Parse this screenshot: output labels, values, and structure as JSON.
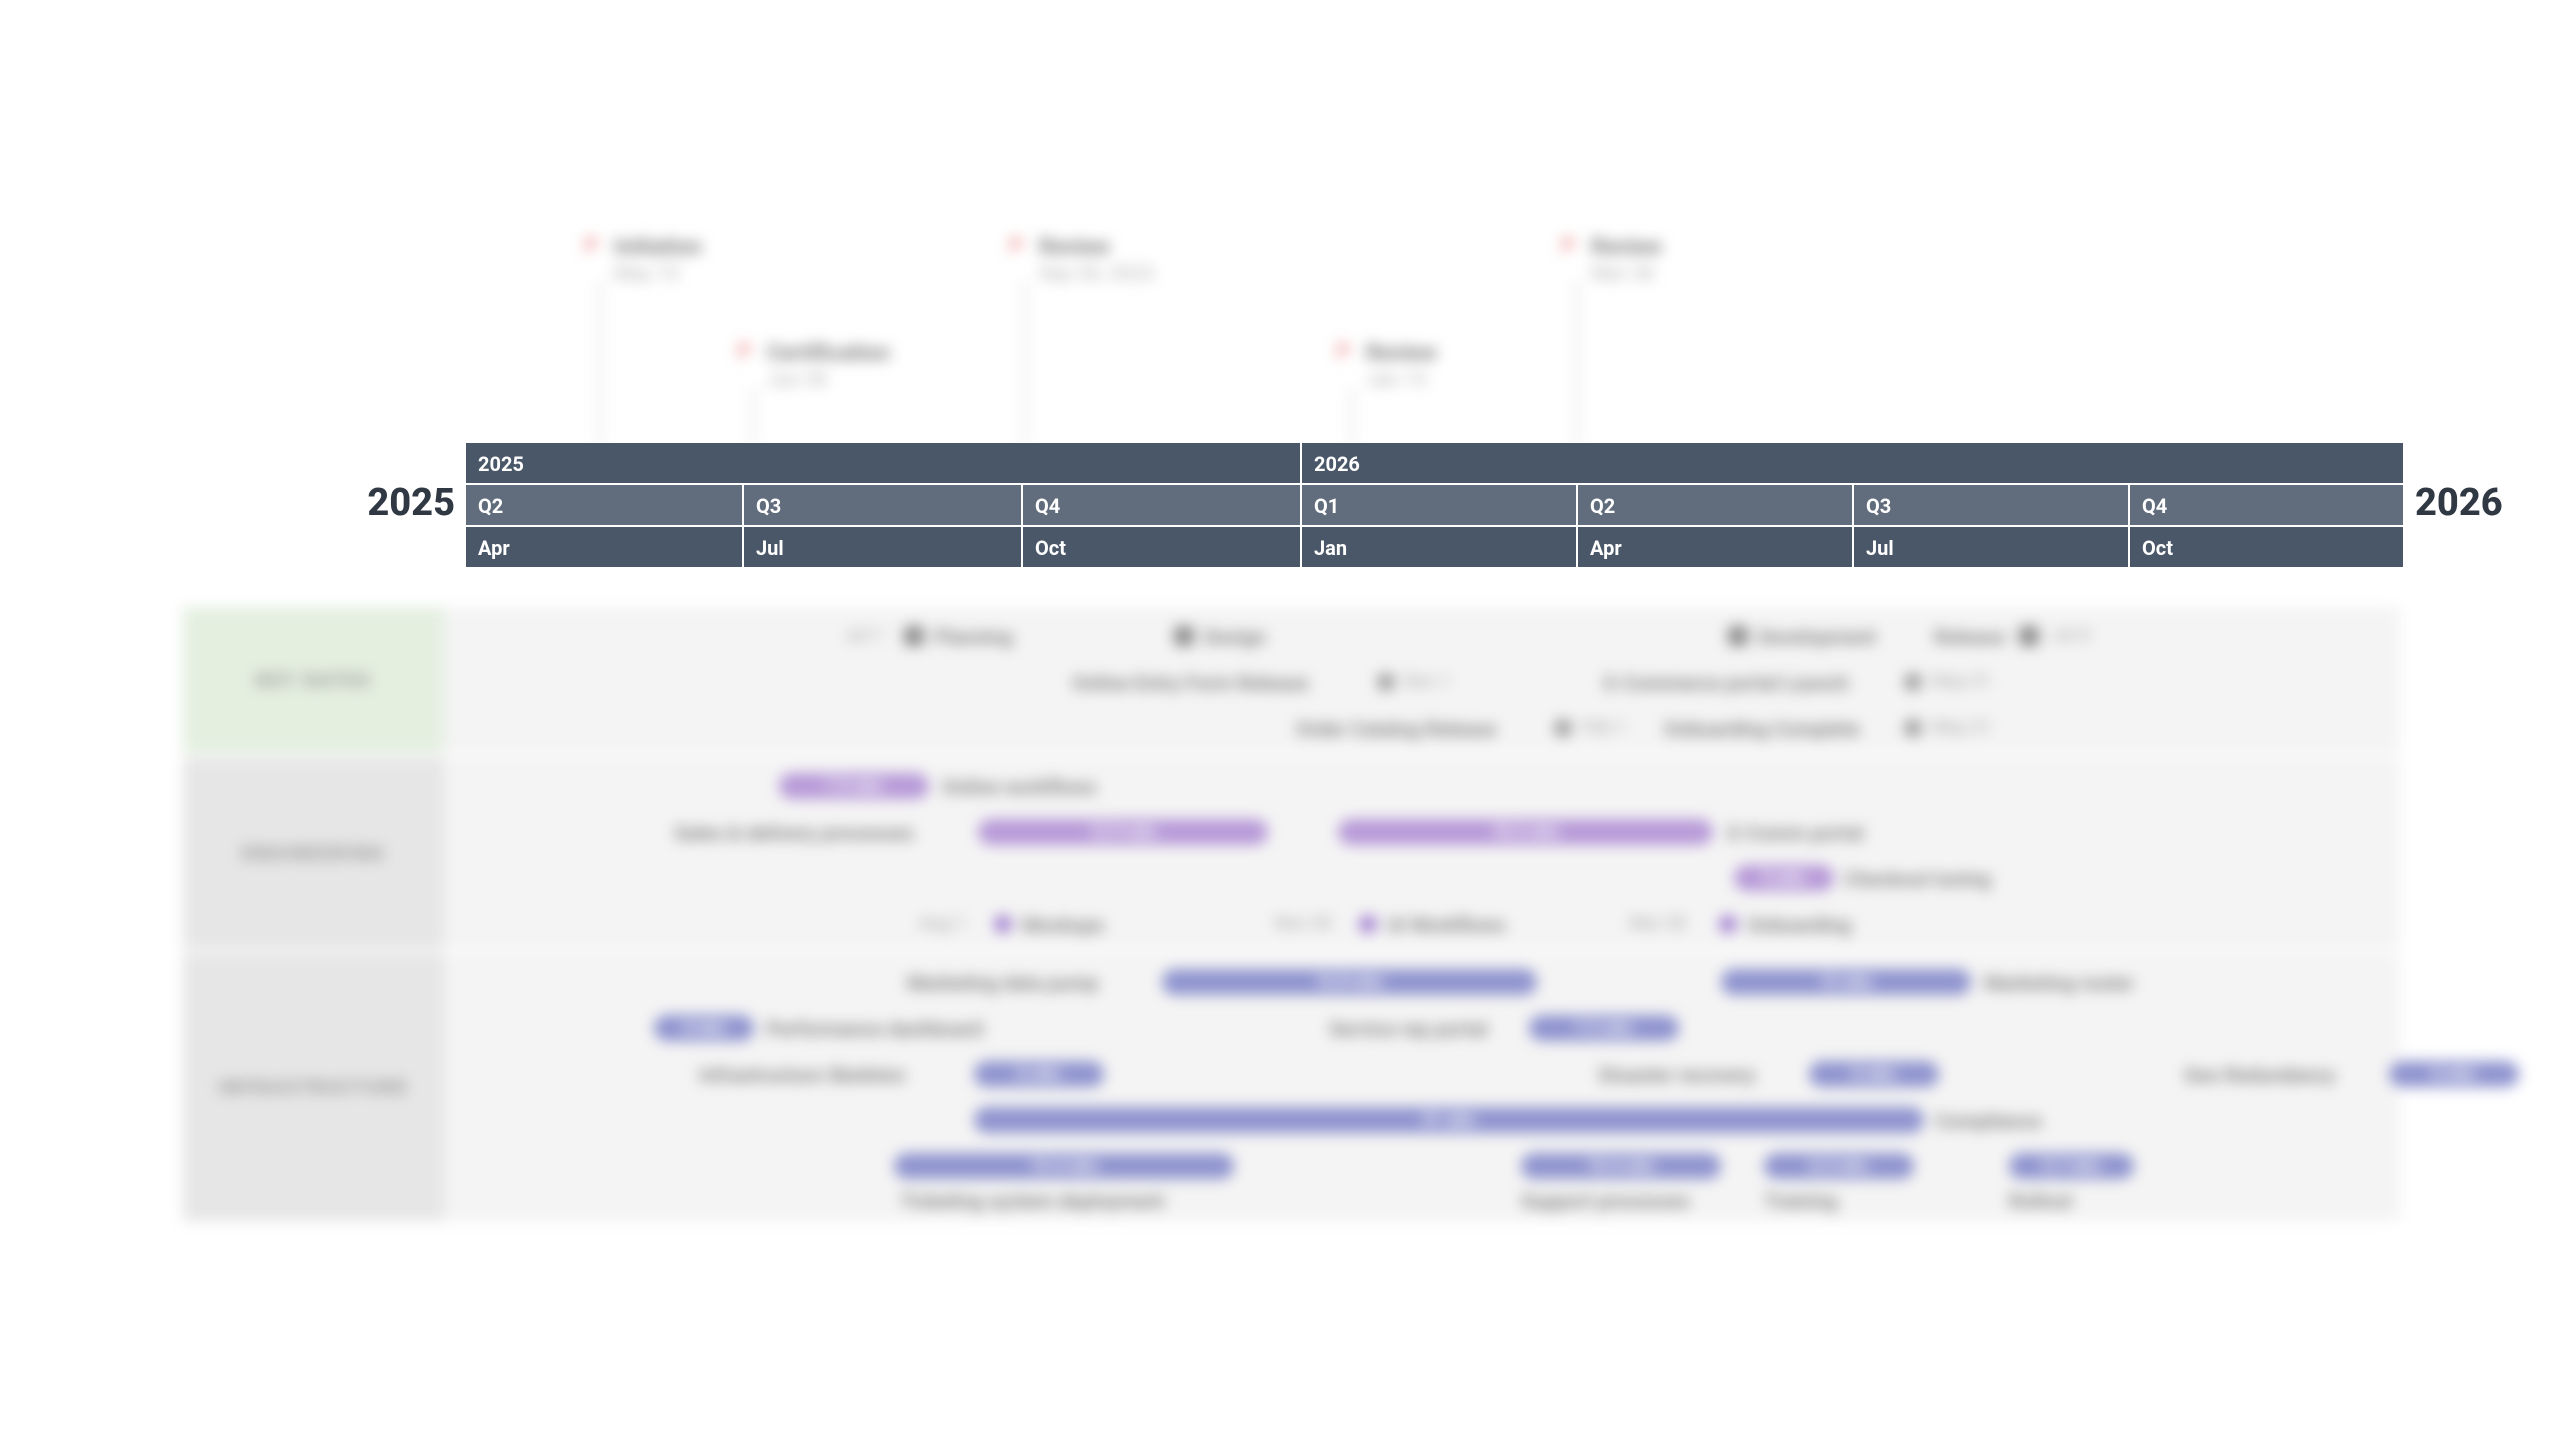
{
  "years": {
    "left": "2025",
    "right": "2026"
  },
  "timescale": {
    "years": [
      {
        "label": "2025",
        "span": 4
      },
      {
        "label": "2026",
        "span": 4
      }
    ],
    "quarters": [
      "Q2",
      "Q3",
      "Q4",
      "Q1",
      "Q2",
      "Q3",
      "Q4"
    ],
    "months": [
      "Apr",
      "Jul",
      "Oct",
      "Jan",
      "Apr",
      "Jul",
      "Oct"
    ]
  },
  "milestones_top": [
    {
      "title": "Initiation",
      "date": "May 10"
    },
    {
      "title": "Review",
      "date": "Sep 30, 2023"
    },
    {
      "title": "Review",
      "date": "Mar 28"
    }
  ],
  "milestones_bottom": [
    {
      "title": "Certification",
      "date": "Jun 30"
    },
    {
      "title": "Review",
      "date": "Jan 13"
    }
  ],
  "lanes": {
    "key_dates": {
      "header": "KEY DATES",
      "row1": {
        "d1": "Jul 1",
        "l1": "Planning",
        "l2": "Design",
        "l3": "Development",
        "l4": "Release",
        "d2": "Jul 6"
      },
      "row2": {
        "l1": "Online Entry Form Release",
        "d1": "Dec 1",
        "l2": "E-Commerce portal Launch",
        "d2": "May 31"
      },
      "row3": {
        "l1": "Order Catalog Release",
        "d1": "Feb 1",
        "l2": "Onboarding Complete",
        "d2": "May 31"
      }
    },
    "engineering": {
      "header": "ENGINEERING",
      "r1": {
        "dur": "7.9 wks",
        "lbl": "Online workflows"
      },
      "r2": {
        "l1": "Sales & delivery processes",
        "d1": "12.9 wks",
        "d2": "18.2 wks",
        "l2": "E-Comm portal"
      },
      "r3": {
        "dur": "5 wks",
        "lbl": "Checkout tuning"
      },
      "r4": {
        "d1": "Aug 1",
        "l1": "Mockups",
        "d2": "Nov 30",
        "l2": "UI Workflows",
        "d3": "Mar 28",
        "l3": "Onboarding"
      }
    },
    "infrastructure": {
      "header": "INFRASTRUCTURE",
      "r1": {
        "l1": "Marketing data pump",
        "d1": "16.8 wks",
        "d2": "12 wks",
        "l2": "Marketing router"
      },
      "r2": {
        "d1": "4 wks",
        "l1": "Performance dashboard",
        "l2": "Service rep portal",
        "d2": "7.2 wks"
      },
      "r3": {
        "l1": "Infrastructure Skeleton",
        "d1": "6 wks",
        "l2": "Disaster recovery",
        "d2": "6 wks",
        "l3": "Geo Redundancy",
        "d3": "6 wks"
      },
      "r4": {
        "d1": "41 wks",
        "l1": "Compliance"
      },
      "r5": {
        "d1": "15.4 wks",
        "l1": "Ticketing system deployment",
        "d2": "10.4 wks",
        "l2": "Support processes",
        "d3": "6.2 wks",
        "l3": "Training",
        "d4": "5.7 wks",
        "l4": "Rollout"
      }
    }
  }
}
